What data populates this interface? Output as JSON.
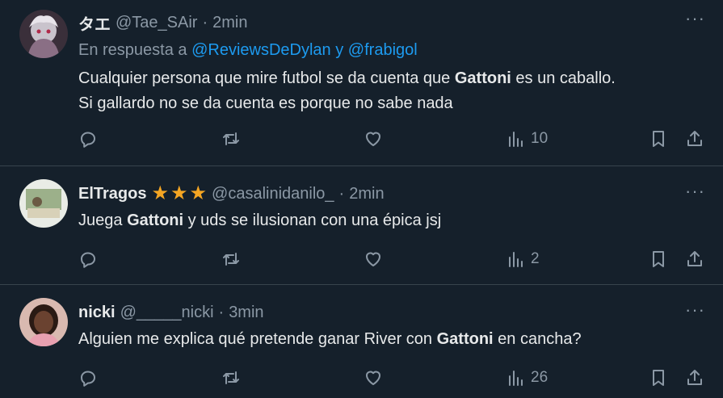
{
  "tweets": [
    {
      "name": "タエ",
      "handle": "@Tae_SAir",
      "dot": "·",
      "time": "2min",
      "reply_prefix": "En respuesta a",
      "reply_mention_1": "@ReviewsDeDylan",
      "reply_and": "y",
      "reply_mention_2": "@frabigol",
      "line1_pre": "Cualquier persona que mire futbol se da cuenta que ",
      "line1_bold": "Gattoni",
      "line1_post": " es un caballo.",
      "line2": "Si gallardo no se da cuenta es porque no sabe nada",
      "views": "10",
      "more": "···"
    },
    {
      "name": "ElTragos",
      "stars": [
        "★",
        "★",
        "★"
      ],
      "handle": "@casalinidanilo_",
      "dot": "·",
      "time": "2min",
      "text_pre": "Juega ",
      "text_bold": "Gattoni",
      "text_post": " y uds se ilusionan con una épica jsj",
      "views": "2",
      "more": "···"
    },
    {
      "name": "nicki",
      "handle": "@_____nicki",
      "dot": "·",
      "time": "3min",
      "text_pre": "Alguien me explica qué pretende ganar River con ",
      "text_bold": "Gattoni",
      "text_post": " en cancha?",
      "views": "26",
      "more": "···"
    }
  ],
  "colors": {
    "background": "#15202b",
    "text": "#e7e9ea",
    "secondary": "#8b98a5",
    "link": "#1d9bf0",
    "divider": "#38444d",
    "star": "#f5a623"
  },
  "icons": [
    "reply-icon",
    "retweet-icon",
    "like-icon",
    "views-icon",
    "bookmark-icon",
    "share-icon",
    "more-icon",
    "star-icon"
  ]
}
